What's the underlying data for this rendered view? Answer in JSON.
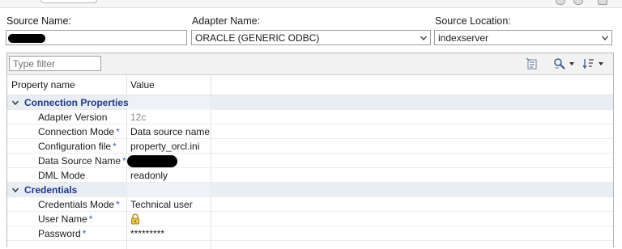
{
  "header": {
    "source_name_label": "Source Name:",
    "adapter_name_label": "Adapter Name:",
    "source_location_label": "Source Location:",
    "source_name_value": "",
    "adapter_name_value": "ORACLE (GENERIC ODBC)",
    "source_location_value": "indexserver"
  },
  "properties": {
    "filter_placeholder": "Type filter",
    "columns": {
      "name": "Property name",
      "value": "Value"
    },
    "categories": [
      {
        "label": "Connection Properties",
        "rows": [
          {
            "name": "Adapter Version",
            "required": "",
            "value": "12c"
          },
          {
            "name": "Connection Mode",
            "required": "*",
            "value": "Data source name"
          },
          {
            "name": "Configuration file",
            "required": "*",
            "value": "property_orcl.ini"
          },
          {
            "name": "Data Source Name",
            "required": "*",
            "value": ""
          },
          {
            "name": "DML Mode",
            "required": "",
            "value": "readonly"
          }
        ]
      },
      {
        "label": "Credentials",
        "rows": [
          {
            "name": "Credentials Mode",
            "required": "*",
            "value": "Technical user"
          },
          {
            "name": "User Name",
            "required": "*",
            "value": ""
          },
          {
            "name": "Password",
            "required": "*",
            "value": "*********"
          }
        ]
      }
    ]
  },
  "icons": {
    "toolbar": [
      "show-categories-icon",
      "filter-tools-icon",
      "sort-icon"
    ],
    "user_value": "lock-icon"
  },
  "colors": {
    "category_text": "#1f3a8a",
    "required_star": "#3062c0",
    "border": "#9e9e9e"
  }
}
